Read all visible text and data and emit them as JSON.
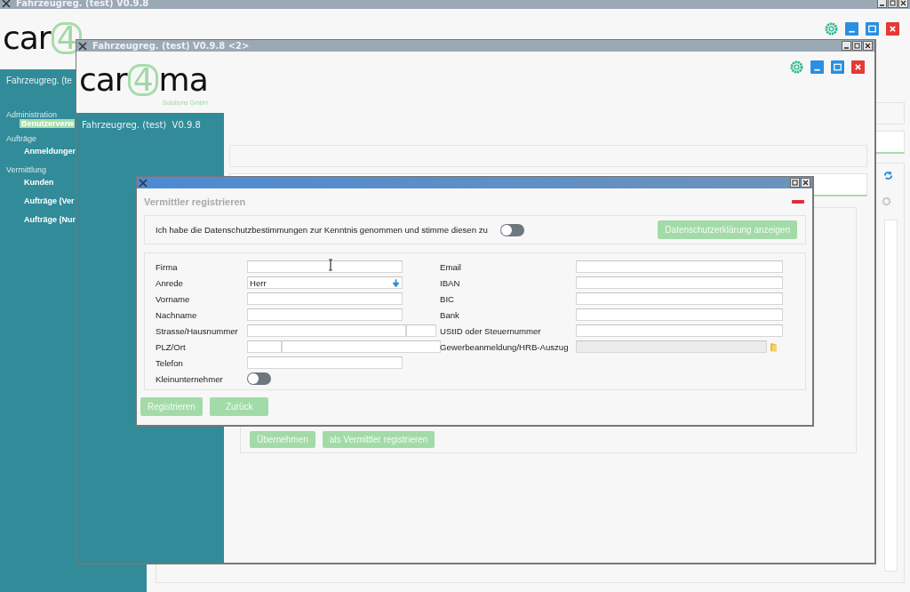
{
  "back_window": {
    "title": "Fahrzeugreg. (test) V0.9.8",
    "logo": [
      "car",
      "4"
    ],
    "sidebar": {
      "header": "Fahrzeugreg. (te",
      "sections": [
        {
          "title": "Administration",
          "items": [
            {
              "label": "Benutzerverw",
              "selected": true
            }
          ]
        },
        {
          "title": "Aufträge",
          "items": [
            {
              "label": "Anmeldungen",
              "selected": false
            }
          ]
        },
        {
          "title": "Vermittlung",
          "items": [
            {
              "label": "Kunden",
              "selected": false
            },
            {
              "label": "Aufträge (Ver",
              "selected": false
            },
            {
              "label": "Aufträge (Nur",
              "selected": false
            }
          ]
        }
      ]
    }
  },
  "front_window": {
    "title": "Fahrzeugreg. (test) V0.9.8 <2>",
    "logo": [
      "car",
      "4",
      "ma"
    ],
    "logo_tagline": "Solutions GmbH",
    "sidebar_header": "Fahrzeugreg. (test)  V0.9.8",
    "buttons": [
      "Übernehmen",
      "als Vermittler registrieren"
    ]
  },
  "dialog": {
    "heading": "Vermittler registrieren",
    "consent": {
      "text": "Ich habe die Datenschutzbestimmungen zur Kenntnis genommen und stimme diesen zu",
      "on": false
    },
    "privacy_button": "Datenschutzerklärung anzeigen",
    "left_fields": [
      {
        "label": "Firma",
        "kind": "text"
      },
      {
        "label": "Anrede",
        "kind": "select",
        "value": "Herr"
      },
      {
        "label": "Vorname",
        "kind": "text"
      },
      {
        "label": "Nachname",
        "kind": "text"
      },
      {
        "label": "Strasse/Hausnummer",
        "kind": "split_right"
      },
      {
        "label": "PLZ/Ort",
        "kind": "split_left"
      },
      {
        "label": "Telefon",
        "kind": "text"
      },
      {
        "label": "Kleinunternehmer",
        "kind": "toggle",
        "on": false
      }
    ],
    "right_fields": [
      {
        "label": "Email",
        "kind": "text"
      },
      {
        "label": "IBAN",
        "kind": "text"
      },
      {
        "label": "BIC",
        "kind": "text"
      },
      {
        "label": "Bank",
        "kind": "text"
      },
      {
        "label": "UStID oder Steuernummer",
        "kind": "text"
      },
      {
        "label": "Gewerbeanmeldung/HRB-Auszug",
        "kind": "file"
      }
    ],
    "buttons": [
      "Registrieren",
      "Zurück"
    ]
  }
}
